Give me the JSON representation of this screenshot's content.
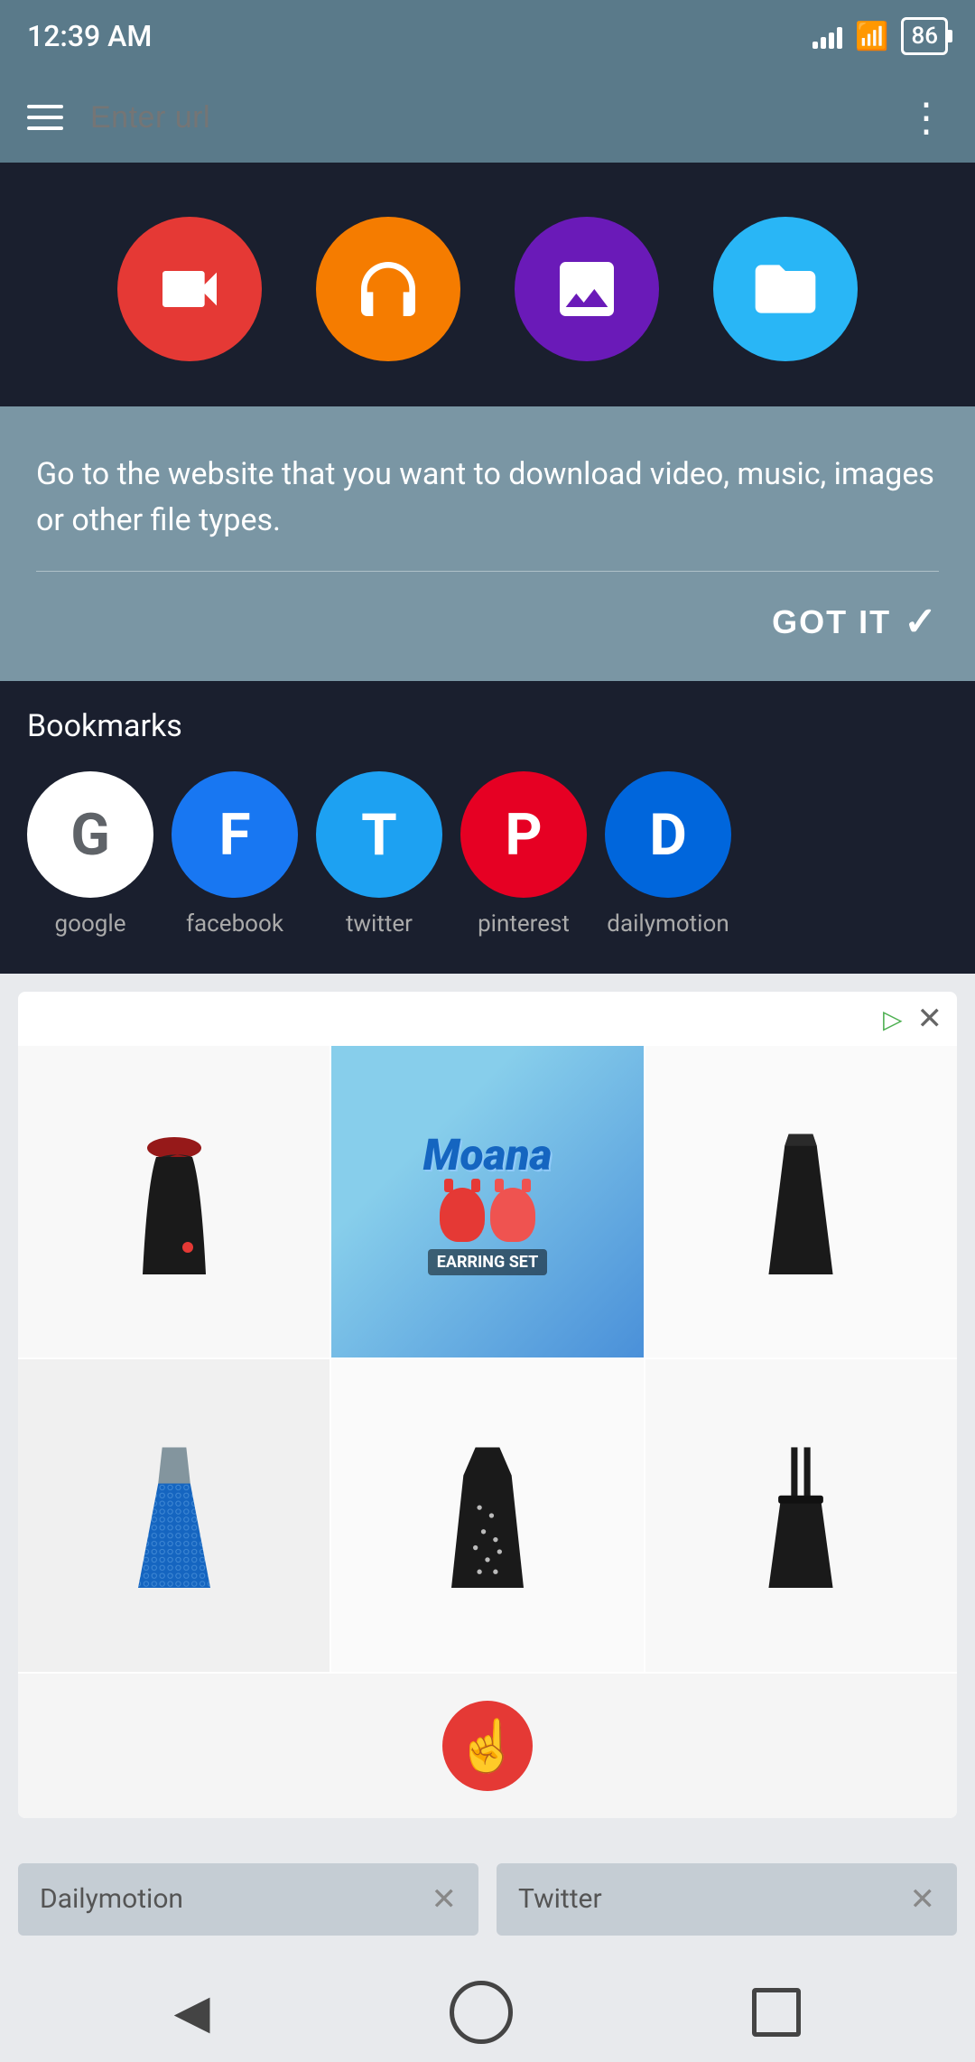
{
  "statusBar": {
    "time": "12:39 AM",
    "battery": "86",
    "signal": 4,
    "wifi": true
  },
  "topBar": {
    "urlPlaceholder": "Enter url",
    "menuIcon": "menu",
    "moreIcon": "more-vertical"
  },
  "heroSection": {
    "buttons": [
      {
        "id": "video",
        "label": "Video",
        "color": "#e53935"
      },
      {
        "id": "music",
        "label": "Music",
        "color": "#f57c00"
      },
      {
        "id": "image",
        "label": "Image",
        "color": "#6a1ab8"
      },
      {
        "id": "folder",
        "label": "Folder",
        "color": "#29b6f6"
      }
    ]
  },
  "tooltip": {
    "text": "Go to the website that you want to download video, music, images or other file types.",
    "gotItLabel": "GOT IT"
  },
  "bookmarks": {
    "title": "Bookmarks",
    "items": [
      {
        "id": "google",
        "label": "google",
        "letter": "G",
        "color": "white",
        "textColor": "#5f6368"
      },
      {
        "id": "facebook",
        "label": "facebook",
        "letter": "F",
        "color": "#1877f2",
        "textColor": "white"
      },
      {
        "id": "twitter",
        "label": "twitter",
        "letter": "T",
        "color": "#1da1f2",
        "textColor": "white"
      },
      {
        "id": "pinterest",
        "label": "pinterest",
        "letter": "P",
        "color": "#e60023",
        "textColor": "white"
      },
      {
        "id": "dailymotion",
        "label": "dailymotion",
        "letter": "D",
        "color": "#0066dc",
        "textColor": "white"
      }
    ]
  },
  "adSection": {
    "images": [
      {
        "id": "dress-1",
        "type": "dress-black-red",
        "alt": "Black dress with red scarf"
      },
      {
        "id": "moana",
        "type": "moana-earrings",
        "alt": "Moana earring set",
        "moanaText": "Moana",
        "earringLabel": "EARRING SET"
      },
      {
        "id": "dress-2",
        "type": "dress-black-sleeveless",
        "alt": "Black sleeveless top"
      },
      {
        "id": "dress-3",
        "type": "dress-blue-lace",
        "alt": "Blue lace dress"
      },
      {
        "id": "dress-4",
        "type": "dress-black-pattern",
        "alt": "Black patterned dress"
      },
      {
        "id": "dress-5",
        "type": "dress-suspender",
        "alt": "Black suspender dress"
      }
    ],
    "handIcon": "☞"
  },
  "bottomTabs": [
    {
      "id": "dailymotion-tab",
      "label": "Dailymotion",
      "closeIcon": "✕"
    },
    {
      "id": "twitter-tab",
      "label": "Twitter",
      "closeIcon": "✕"
    }
  ],
  "navBar": {
    "back": "◀",
    "home": "circle",
    "recent": "square"
  }
}
